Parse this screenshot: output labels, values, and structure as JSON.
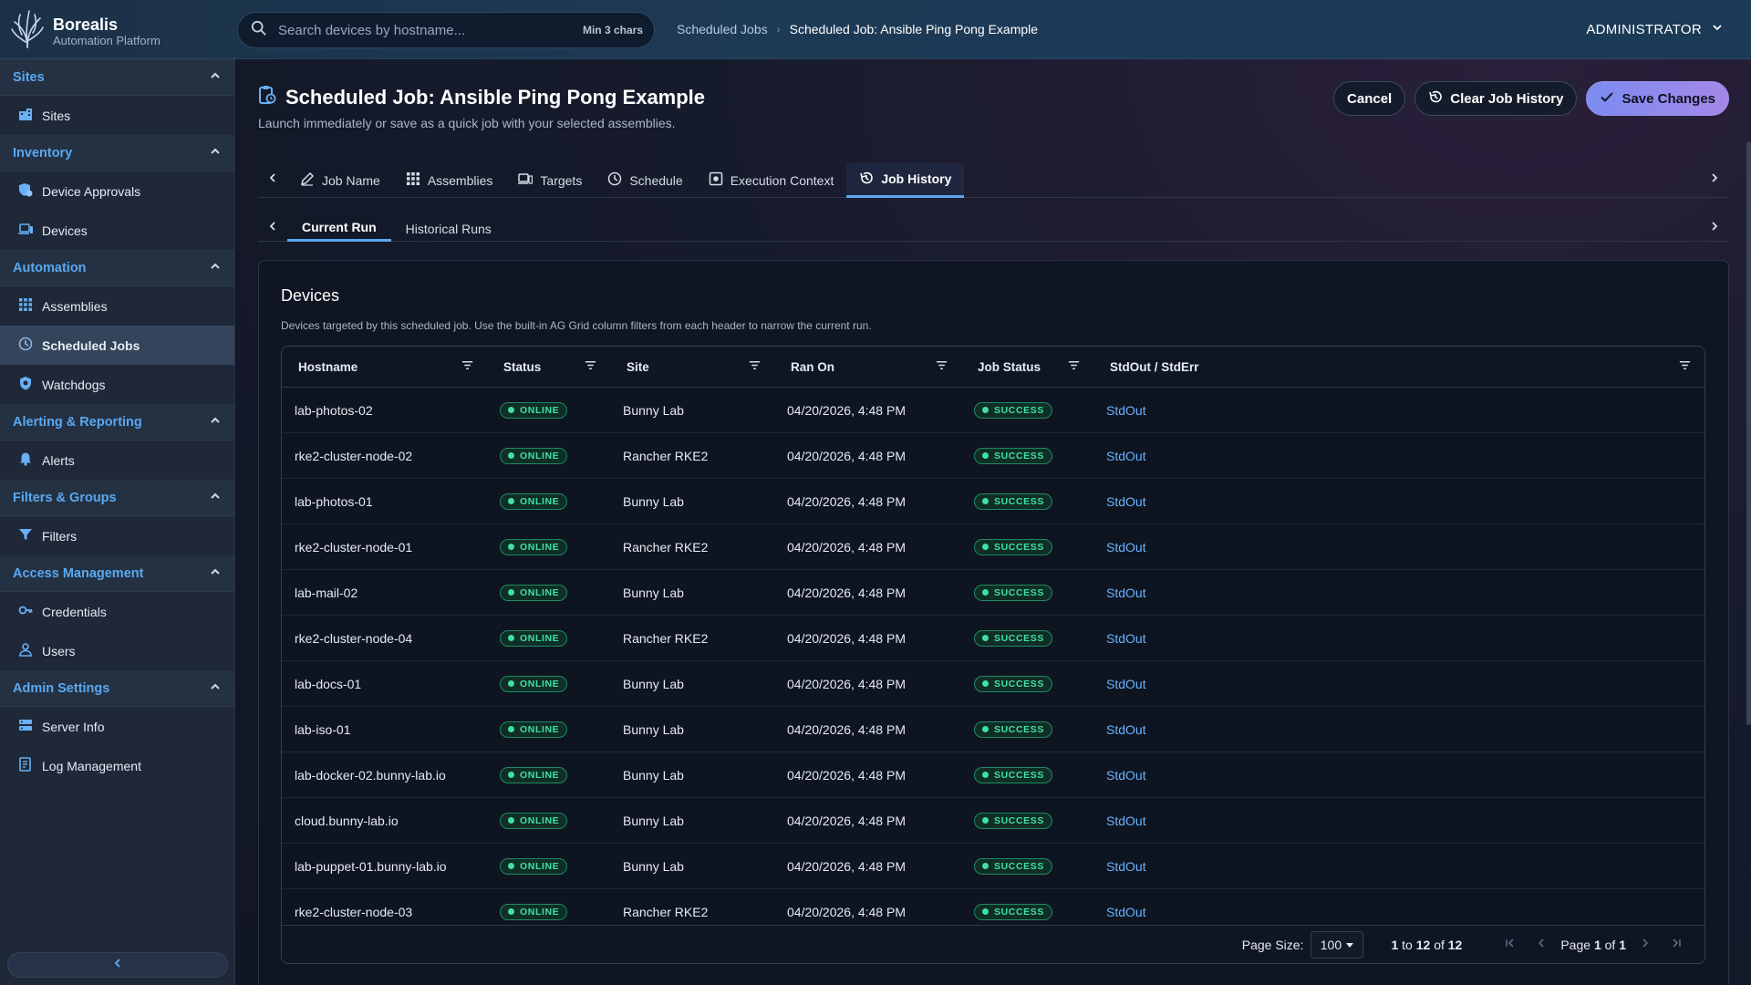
{
  "brand": {
    "name": "Borealis",
    "subtitle": "Automation Platform"
  },
  "search": {
    "placeholder": "Search devices by hostname...",
    "hint": "Min 3 chars"
  },
  "breadcrumb": {
    "parent": "Scheduled Jobs",
    "separator": "›",
    "current": "Scheduled Job: Ansible Ping Pong Example"
  },
  "user": {
    "label": "ADMINISTRATOR"
  },
  "sidebar": {
    "sections": [
      {
        "title": "Sites",
        "items": [
          {
            "label": "Sites",
            "icon": "building-icon"
          }
        ]
      },
      {
        "title": "Inventory",
        "items": [
          {
            "label": "Device Approvals",
            "icon": "shield-check-icon"
          },
          {
            "label": "Devices",
            "icon": "laptop-icon"
          }
        ]
      },
      {
        "title": "Automation",
        "items": [
          {
            "label": "Assemblies",
            "icon": "grid-icon"
          },
          {
            "label": "Scheduled Jobs",
            "icon": "clock-icon",
            "active": true
          },
          {
            "label": "Watchdogs",
            "icon": "watchdog-icon"
          }
        ]
      },
      {
        "title": "Alerting & Reporting",
        "items": [
          {
            "label": "Alerts",
            "icon": "bell-icon"
          }
        ]
      },
      {
        "title": "Filters & Groups",
        "items": [
          {
            "label": "Filters",
            "icon": "filter-icon"
          }
        ]
      },
      {
        "title": "Access Management",
        "items": [
          {
            "label": "Credentials",
            "icon": "key-icon"
          },
          {
            "label": "Users",
            "icon": "user-icon"
          }
        ]
      },
      {
        "title": "Admin Settings",
        "items": [
          {
            "label": "Server Info",
            "icon": "server-icon"
          },
          {
            "label": "Log Management",
            "icon": "log-icon"
          }
        ]
      }
    ]
  },
  "page": {
    "title": "Scheduled Job: Ansible Ping Pong Example",
    "subtitle": "Launch immediately or save as a quick job with your selected assemblies.",
    "actions": {
      "cancel": "Cancel",
      "clear_history": "Clear Job History",
      "save": "Save Changes"
    }
  },
  "tabs": [
    {
      "label": "Job Name",
      "icon": "pencil-icon"
    },
    {
      "label": "Assemblies",
      "icon": "grid-icon"
    },
    {
      "label": "Targets",
      "icon": "devices-icon"
    },
    {
      "label": "Schedule",
      "icon": "clock-icon"
    },
    {
      "label": "Execution Context",
      "icon": "context-icon"
    },
    {
      "label": "Job History",
      "icon": "history-icon",
      "active": true
    }
  ],
  "subtabs": [
    {
      "label": "Current Run",
      "active": true
    },
    {
      "label": "Historical Runs"
    }
  ],
  "devices_card": {
    "title": "Devices",
    "description": "Devices targeted by this scheduled job. Use the built-in AG Grid column filters from each header to narrow the current run."
  },
  "table": {
    "columns": [
      "Hostname",
      "Status",
      "Site",
      "Ran On",
      "Job Status",
      "StdOut / StdErr"
    ],
    "rows": [
      {
        "hostname": "lab-photos-02",
        "status": "ONLINE",
        "site": "Bunny Lab",
        "ran_on": "04/20/2026, 4:48 PM",
        "job_status": "SUCCESS",
        "output": "StdOut"
      },
      {
        "hostname": "rke2-cluster-node-02",
        "status": "ONLINE",
        "site": "Rancher RKE2",
        "ran_on": "04/20/2026, 4:48 PM",
        "job_status": "SUCCESS",
        "output": "StdOut"
      },
      {
        "hostname": "lab-photos-01",
        "status": "ONLINE",
        "site": "Bunny Lab",
        "ran_on": "04/20/2026, 4:48 PM",
        "job_status": "SUCCESS",
        "output": "StdOut"
      },
      {
        "hostname": "rke2-cluster-node-01",
        "status": "ONLINE",
        "site": "Rancher RKE2",
        "ran_on": "04/20/2026, 4:48 PM",
        "job_status": "SUCCESS",
        "output": "StdOut"
      },
      {
        "hostname": "lab-mail-02",
        "status": "ONLINE",
        "site": "Bunny Lab",
        "ran_on": "04/20/2026, 4:48 PM",
        "job_status": "SUCCESS",
        "output": "StdOut"
      },
      {
        "hostname": "rke2-cluster-node-04",
        "status": "ONLINE",
        "site": "Rancher RKE2",
        "ran_on": "04/20/2026, 4:48 PM",
        "job_status": "SUCCESS",
        "output": "StdOut"
      },
      {
        "hostname": "lab-docs-01",
        "status": "ONLINE",
        "site": "Bunny Lab",
        "ran_on": "04/20/2026, 4:48 PM",
        "job_status": "SUCCESS",
        "output": "StdOut"
      },
      {
        "hostname": "lab-iso-01",
        "status": "ONLINE",
        "site": "Bunny Lab",
        "ran_on": "04/20/2026, 4:48 PM",
        "job_status": "SUCCESS",
        "output": "StdOut"
      },
      {
        "hostname": "lab-docker-02.bunny-lab.io",
        "status": "ONLINE",
        "site": "Bunny Lab",
        "ran_on": "04/20/2026, 4:48 PM",
        "job_status": "SUCCESS",
        "output": "StdOut"
      },
      {
        "hostname": "cloud.bunny-lab.io",
        "status": "ONLINE",
        "site": "Bunny Lab",
        "ran_on": "04/20/2026, 4:48 PM",
        "job_status": "SUCCESS",
        "output": "StdOut"
      },
      {
        "hostname": "lab-puppet-01.bunny-lab.io",
        "status": "ONLINE",
        "site": "Bunny Lab",
        "ran_on": "04/20/2026, 4:48 PM",
        "job_status": "SUCCESS",
        "output": "StdOut"
      },
      {
        "hostname": "rke2-cluster-node-03",
        "status": "ONLINE",
        "site": "Rancher RKE2",
        "ran_on": "04/20/2026, 4:48 PM",
        "job_status": "SUCCESS",
        "output": "StdOut"
      }
    ]
  },
  "pagination": {
    "page_size_label": "Page Size:",
    "page_size": "100",
    "range_from": "1",
    "range_to_word": "to",
    "range_to": "12",
    "of_word": "of",
    "total": "12",
    "page_word": "Page",
    "current_page": "1",
    "total_pages": "1"
  },
  "colors": {
    "accent": "#5aa8f0",
    "success": "#3fe0a4",
    "link": "#68b4ff",
    "primary_button": "#7b8cf0"
  }
}
